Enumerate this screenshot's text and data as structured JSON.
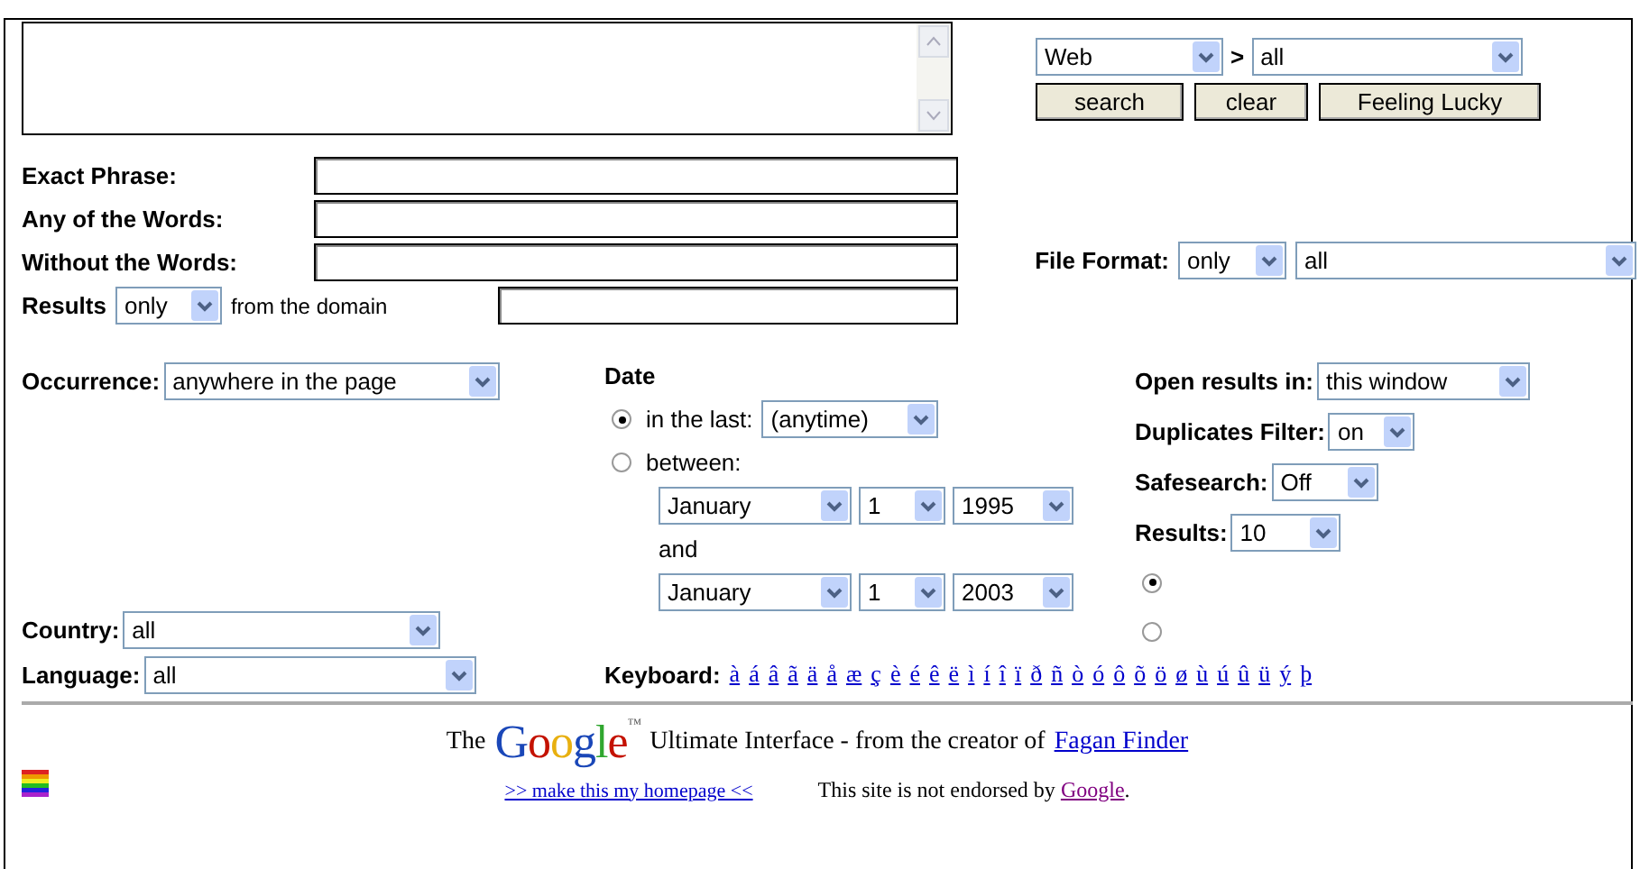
{
  "scope": {
    "type": "Web",
    "separator": ">",
    "subtype": "all"
  },
  "buttons": [
    "search",
    "clear",
    "Feeling Lucky"
  ],
  "fields": [
    {
      "label": "Exact Phrase:"
    },
    {
      "label": "Any of the Words:"
    },
    {
      "label": "Without the Words:"
    }
  ],
  "domain": {
    "label": "Results",
    "mode": "only",
    "suffix": "from the domain"
  },
  "file_format": {
    "label": "File Format:",
    "mode": "only",
    "type": "all"
  },
  "occurrence": {
    "label": "Occurrence:",
    "value": "anywhere in the page"
  },
  "date": {
    "title": "Date",
    "options": [
      {
        "label": "in the last:",
        "selected": true,
        "value": "(anytime)"
      },
      {
        "label": "between:",
        "selected": false
      }
    ],
    "from": {
      "month": "January",
      "day": "1",
      "year": "1995"
    },
    "and": "and",
    "to": {
      "month": "January",
      "day": "1",
      "year": "2003"
    }
  },
  "settings": [
    {
      "label": "Open results in:",
      "value": "this window"
    },
    {
      "label": "Duplicates Filter:",
      "value": "on"
    },
    {
      "label": "Safesearch:",
      "value": "Off"
    },
    {
      "label": "Results:",
      "value": "10"
    }
  ],
  "result_radios": [
    {
      "selected": true
    },
    {
      "selected": false
    }
  ],
  "country": {
    "label": "Country:",
    "value": "all"
  },
  "language": {
    "label": "Language:",
    "value": "all"
  },
  "keyboard": {
    "label": "Keyboard:",
    "chars": [
      "à",
      "á",
      "â",
      "ã",
      "ä",
      "å",
      "æ",
      "ç",
      "è",
      "é",
      "ê",
      "ë",
      "ì",
      "í",
      "î",
      "ï",
      "ð",
      "ñ",
      "ò",
      "ó",
      "ô",
      "õ",
      "ö",
      "ø",
      "ù",
      "ú",
      "û",
      "ü",
      "ý",
      "þ"
    ]
  },
  "footer": {
    "prefix": "The",
    "logo": "Google",
    "tm": "™",
    "text": "Ultimate Interface - from the creator of",
    "link": "Fagan Finder",
    "homepage_link": ">> make this my homepage <<",
    "notice": "This site is not endorsed by",
    "notice_link": "Google",
    "notice_end": "."
  }
}
